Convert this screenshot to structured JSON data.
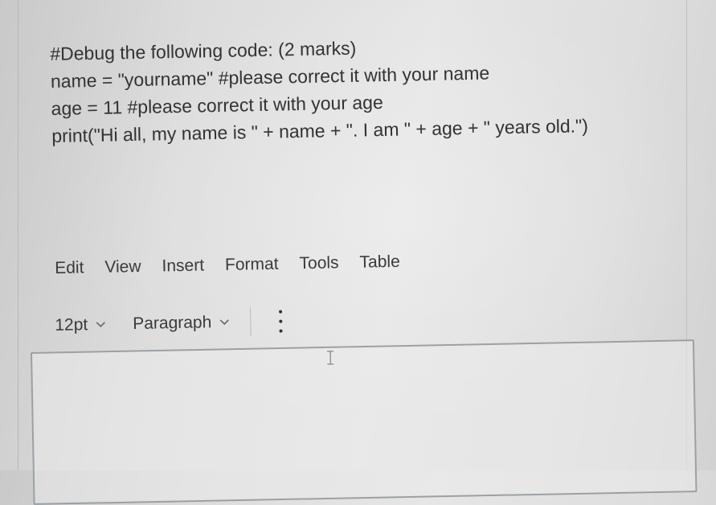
{
  "question": {
    "lines": [
      "#Debug the following code: (2 marks)",
      "name = \"yourname\" #please correct it with your name",
      "age = 11 #please correct it with your age",
      "print(\"Hi all, my name is \" + name + \". I am \" + age + \" years old.\")"
    ]
  },
  "editor_menu": {
    "items": [
      "Edit",
      "View",
      "Insert",
      "Format",
      "Tools",
      "Table"
    ]
  },
  "toolbar": {
    "font_size": "12pt",
    "block_format": "Paragraph",
    "more_icon": "vertical-ellipsis-icon",
    "chevron_icon": "chevron-down-icon"
  },
  "editor": {
    "content": "",
    "cursor_icon": "text-cursor-icon"
  },
  "colors": {
    "text": "#333333",
    "editor_border": "#9aa1a6"
  }
}
